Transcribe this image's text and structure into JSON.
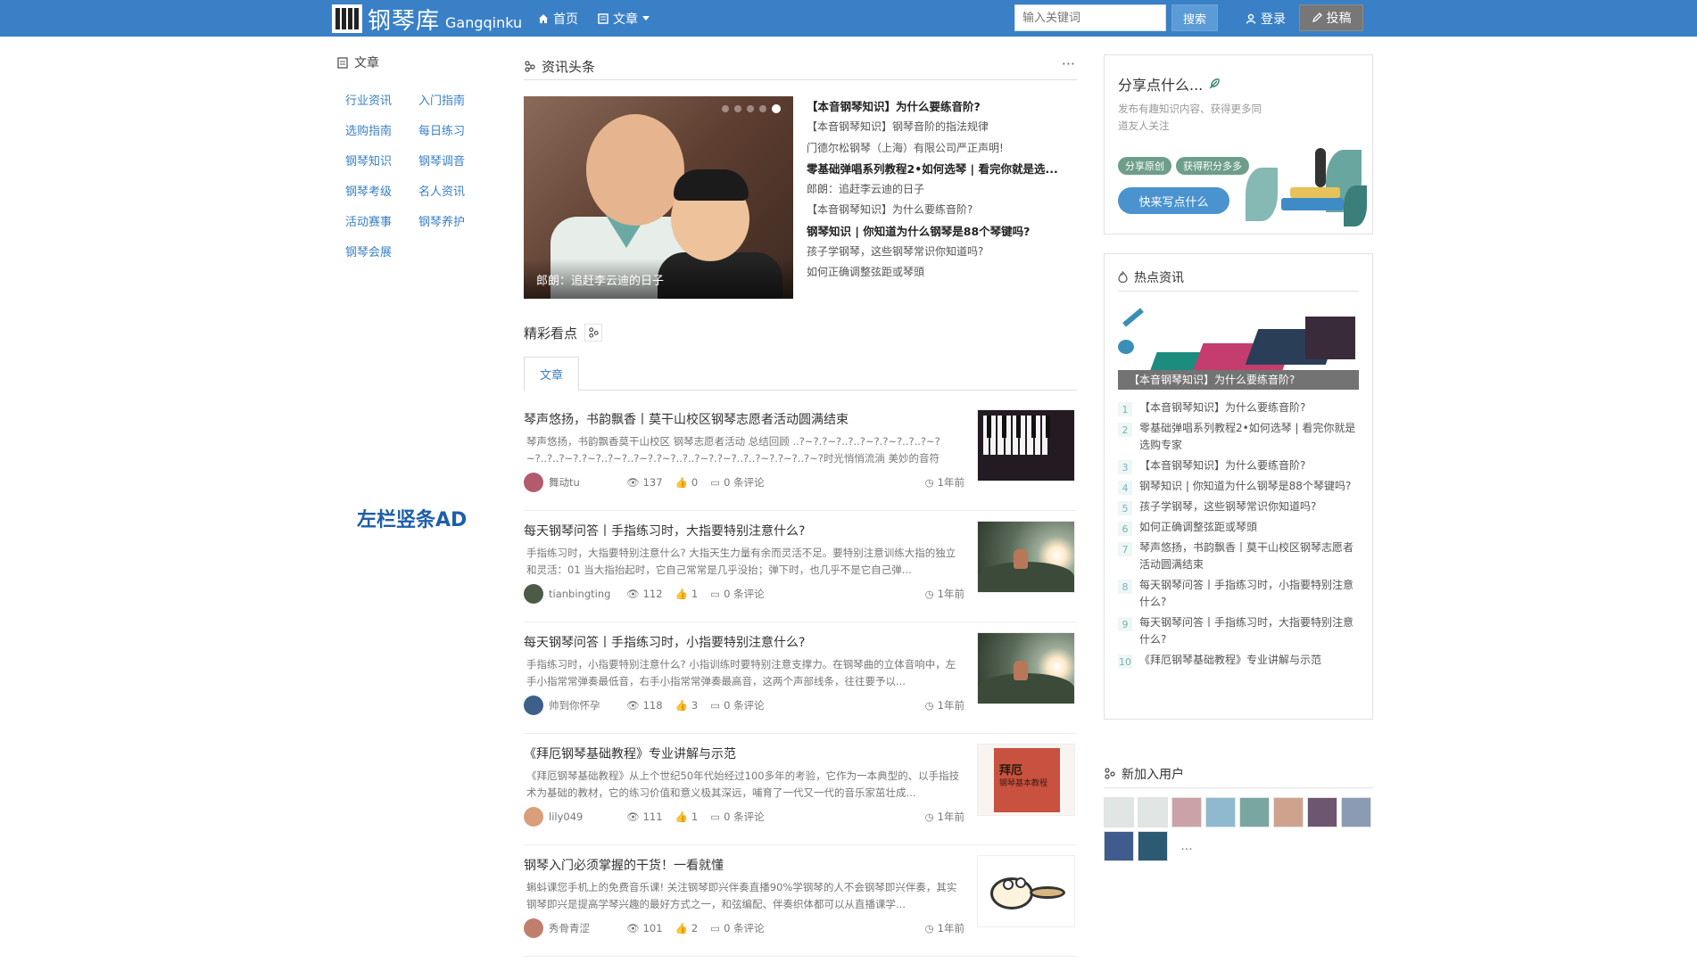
{
  "nav": {
    "logo_cn": "钢琴库",
    "logo_en": "Gangqinku",
    "home": "首页",
    "articles": "文章",
    "search_placeholder": "输入关键词",
    "search_btn": "搜索",
    "login": "登录",
    "post": "投稿"
  },
  "left": {
    "heading": "文章",
    "categories": [
      "行业资讯",
      "入门指南",
      "选购指南",
      "每日练习",
      "钢琴知识",
      "钢琴调音",
      "钢琴考级",
      "名人资讯",
      "活动赛事",
      "钢琴养护",
      "钢琴会展"
    ],
    "ad": "左栏竖条AD"
  },
  "news": {
    "heading": "资讯头条",
    "more": "···",
    "carousel_caption": "郎朗：追赶李云迪的日子",
    "headlines": [
      {
        "text": "【本音钢琴知识】为什么要练音阶?",
        "bold": true
      },
      {
        "text": "【本音钢琴知识】钢琴音阶的指法规律",
        "bold": false
      },
      {
        "text": "门德尔松钢琴（上海）有限公司严正声明!",
        "bold": false
      },
      {
        "text": "零基础弹唱系列教程2•如何选琴 | 看完你就是选...",
        "bold": true
      },
      {
        "text": "郎朗：追赶李云迪的日子",
        "bold": false
      },
      {
        "text": "【本音钢琴知识】为什么要练音阶?",
        "bold": false
      },
      {
        "text": "钢琴知识 | 你知道为什么钢琴是88个琴键吗?",
        "bold": true
      },
      {
        "text": "孩子学钢琴，这些钢琴常识你知道吗?",
        "bold": false
      },
      {
        "text": "如何正确调整弦距或琴頭",
        "bold": false
      }
    ]
  },
  "featured": {
    "heading": "精彩看点",
    "tab": "文章",
    "articles": [
      {
        "title": "琴声悠扬，书韵飘香丨莫干山校区钢琴志愿者活动圆满结束",
        "summary": "琴声悠扬，书韵飘香莫干山校区 钢琴志愿者活动 总结回顾 ..?~?.?~?..?..?~?.?~?..?..?~? ~?..?..?~?.?~?..?~?..?~?.?~?..?..?~?.?~?..?..?~?.?~?..?~?时光悄悄流淌 美妙的音符 在...",
        "author": "舞动tu",
        "views": "137",
        "likes": "0",
        "comments": "0 条评论",
        "time": "1年前"
      },
      {
        "title": "每天钢琴问答丨手指练习时，大指要特别注意什么?",
        "summary": "手指练习时，大指要特别注意什么? 大指天生力量有余而灵活不足。要特别注意训练大指的独立和灵活：01 当大指抬起时，它自己常常是几乎没抬；弹下时，也几乎不是它自己弹...",
        "author": "tianbingting",
        "views": "112",
        "likes": "1",
        "comments": "0 条评论",
        "time": "1年前"
      },
      {
        "title": "每天钢琴问答丨手指练习时，小指要特别注意什么?",
        "summary": "手指练习时，小指要特别注意什么? 小指训练时要特别注意支撑力。在钢琴曲的立体音响中，左手小指常常弹奏最低音，右手小指常常弹奏最高音，这两个声部线条，往往要予以...",
        "author": "帅到你怀孕",
        "views": "118",
        "likes": "3",
        "comments": "0 条评论",
        "time": "1年前"
      },
      {
        "title": "《拜厄钢琴基础教程》专业讲解与示范",
        "summary": "《拜厄钢琴基础教程》从上个世纪50年代始经过100多年的考验，它作为一本典型的、以手指技术为基础的教材，它的练习价值和意义极其深远，哺育了一代又一代的音乐家茁壮成...",
        "author": "lily049",
        "views": "111",
        "likes": "1",
        "comments": "0 条评论",
        "time": "1年前"
      },
      {
        "title": "钢琴入门必须掌握的干货！一看就懂",
        "summary": "蝌蚪课您手机上的免费音乐课! 关注钢琴即兴伴奏直播90%学钢琴的人不会钢琴即兴伴奏，其实钢琴即兴是提高学琴兴趣的最好方式之一，和弦编配、伴奏织体都可以从直播课学...",
        "author": "秀骨青涩",
        "views": "101",
        "likes": "2",
        "comments": "0 条评论",
        "time": "1年前"
      }
    ],
    "book_cover_title": "拜厄",
    "book_cover_sub": "钢琴基本教程"
  },
  "share": {
    "title": "分享点什么...",
    "desc": "发布有趣知识内容、获得更多同道友人关注",
    "tag1": "分享原创",
    "tag2": "获得积分多多",
    "button": "快来写点什么"
  },
  "hot": {
    "heading": "热点资讯",
    "image_caption": "【本音钢琴知识】为什么要练音阶?",
    "items": [
      "【本音钢琴知识】为什么要练音阶?",
      "零基础弹唱系列教程2•如何选琴 | 看完你就是选购专家",
      "【本音钢琴知识】为什么要练音阶?",
      "钢琴知识 | 你知道为什么钢琴是88个琴键吗?",
      "孩子学钢琴，这些钢琴常识你知道吗?",
      "如何正确调整弦距或琴頭",
      "琴声悠扬，书韵飘香丨莫干山校区钢琴志愿者活动圆满结束",
      "每天钢琴问答丨手指练习时，小指要特别注意什么?",
      "每天钢琴问答丨手指练习时，大指要特别注意什么?",
      "《拜厄钢琴基础教程》专业讲解与示范"
    ]
  },
  "users": {
    "heading": "新加入用户",
    "more": "...",
    "avatar_colors": [
      "#dfe6e3",
      "#dfe6e3",
      "#caa2a8",
      "#8fb9cf",
      "#7aa6a1",
      "#cfa28e",
      "#6d5670",
      "#8a9bb3",
      "#3f5c8c",
      "#2c5a72"
    ]
  },
  "colors": {
    "nav_bg": "#3a80c6",
    "link": "#3a80c6",
    "accent_button": "#4a93cf"
  }
}
